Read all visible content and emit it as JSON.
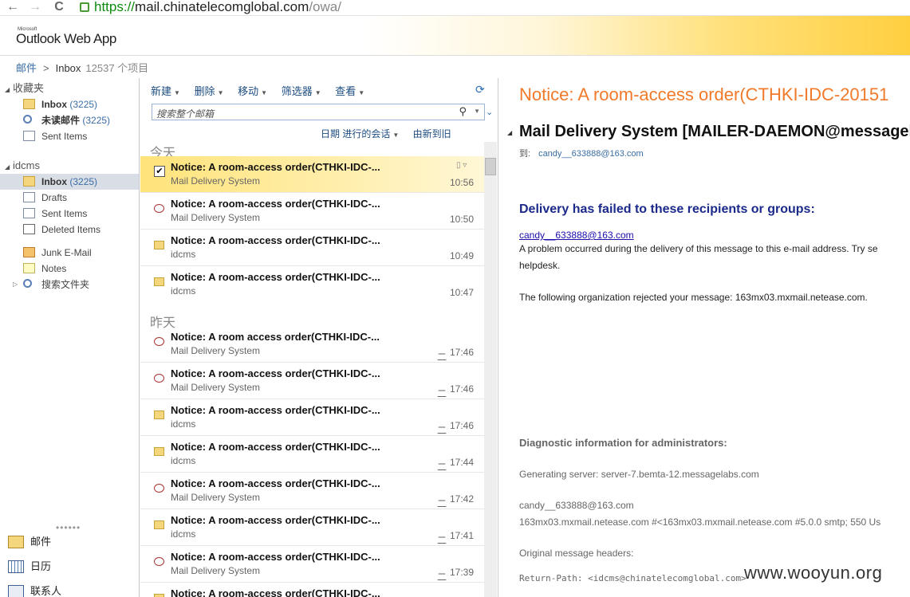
{
  "browser": {
    "back_glyph": "←",
    "forward_glyph": "→",
    "reload_glyph": "C",
    "url_scheme": "https://",
    "url_host": "mail.chinatelecomglobal.com",
    "url_path": "/owa/"
  },
  "app": {
    "logo_small": "Microsoft",
    "logo": "Outlook Web App"
  },
  "breadcrumb": {
    "root": "邮件",
    "separator": ">",
    "folder": "Inbox",
    "count": "12537 个项目"
  },
  "favorites": {
    "header": "收藏夹",
    "items": [
      {
        "label": "Inbox",
        "count": "(3225)",
        "icon": "inbox-icon"
      },
      {
        "label": "未读邮件",
        "count": "(3225)",
        "icon": "search-folder-icon"
      },
      {
        "label": "Sent Items",
        "count": "",
        "icon": "sent-icon"
      }
    ]
  },
  "mailbox": {
    "header": "idcms",
    "items": [
      {
        "label": "Inbox",
        "count": "(3225)",
        "icon": "inbox-icon"
      },
      {
        "label": "Drafts",
        "icon": "drafts-icon"
      },
      {
        "label": "Sent Items",
        "icon": "sent-icon"
      },
      {
        "label": "Deleted Items",
        "icon": "deleted-icon"
      },
      {
        "label": "Junk E-Mail",
        "icon": "junk-icon"
      },
      {
        "label": "Notes",
        "icon": "notes-icon"
      },
      {
        "label": "搜索文件夹",
        "icon": "search-folder-icon"
      }
    ]
  },
  "modules": {
    "dots": "••••••",
    "mail": "邮件",
    "calendar": "日历",
    "contacts": "联系人"
  },
  "toolbar": {
    "new": "新建",
    "delete": "删除",
    "move": "移动",
    "filter": "筛选器",
    "view": "查看"
  },
  "search": {
    "placeholder": "搜索整个邮箱"
  },
  "sort": {
    "by": "日期 进行的会话",
    "order": "由新到旧"
  },
  "list": {
    "today": "今天",
    "yesterday": "昨天",
    "today_rows": [
      {
        "subject": "Notice: A room-access order(CTHKI-IDC-...",
        "from": "Mail Delivery System",
        "time": "10:56",
        "icon": "checkbox-checked"
      },
      {
        "subject": "Notice: A room-access order(CTHKI-IDC-...",
        "from": "Mail Delivery System",
        "time": "10:50",
        "icon": "ndr-icon"
      },
      {
        "subject": "Notice: A room-access order(CTHKI-IDC-...",
        "from": "idcms",
        "time": "10:49",
        "icon": "envelope-icon"
      },
      {
        "subject": "Notice: A room-access order(CTHKI-IDC-...",
        "from": "idcms",
        "time": "10:47",
        "icon": "envelope-icon"
      }
    ],
    "yesterday_rows": [
      {
        "subject": "Notice: A room access order(CTHKI-IDC-...",
        "from": "Mail Delivery System",
        "day": "二",
        "time": "17:46",
        "icon": "ndr-icon"
      },
      {
        "subject": "Notice: A room-access order(CTHKI-IDC-...",
        "from": "Mail Delivery System",
        "day": "二",
        "time": "17:46",
        "icon": "ndr-icon"
      },
      {
        "subject": "Notice: A room-access order(CTHKI-IDC-...",
        "from": "idcms",
        "day": "二",
        "time": "17:46",
        "icon": "envelope-icon"
      },
      {
        "subject": "Notice: A room-access order(CTHKI-IDC-...",
        "from": "idcms",
        "day": "二",
        "time": "17:44",
        "icon": "envelope-icon"
      },
      {
        "subject": "Notice: A room-access order(CTHKI-IDC-...",
        "from": "Mail Delivery System",
        "day": "二",
        "time": "17:42",
        "icon": "ndr-icon"
      },
      {
        "subject": "Notice: A room-access order(CTHKI-IDC-...",
        "from": "idcms",
        "day": "二",
        "time": "17:41",
        "icon": "envelope-icon"
      },
      {
        "subject": "Notice: A room-access order(CTHKI-IDC-...",
        "from": "Mail Delivery System",
        "day": "二",
        "time": "17:39",
        "icon": "ndr-icon"
      },
      {
        "subject": "Notice: A room-access order(CTHKI-IDC-...",
        "from": "",
        "day": "",
        "time": "",
        "icon": "envelope-icon"
      }
    ]
  },
  "reading": {
    "subject": "Notice: A room-access order(CTHKI-IDC-20151",
    "sender": "Mail Delivery System [MAILER-DAEMON@messagela",
    "to_label": "到:",
    "to_value": "candy__633888@163.com",
    "failed_heading": "Delivery has failed to these recipients or groups:",
    "recipient": "candy__633888@163.com",
    "problem_line1": "A problem occurred during the delivery of this message to this e-mail address. Try se",
    "problem_line2": "helpdesk.",
    "rejected": "The following organization rejected your message: 163mx03.mxmail.netease.com.",
    "diag_heading": "Diagnostic information for administrators:",
    "gen_server": "Generating server: server-7.bemta-12.messagelabs.com",
    "diag_recipient": "candy__633888@163.com",
    "diag_line": "163mx03.mxmail.netease.com #<163mx03.mxmail.netease.com #5.0.0 smtp; 550 Us",
    "orig_headers": "Original message headers:",
    "return_path": "Return-Path: <idcms@chinatelecomglobal.com>"
  },
  "watermark": "www.wooyun.org"
}
